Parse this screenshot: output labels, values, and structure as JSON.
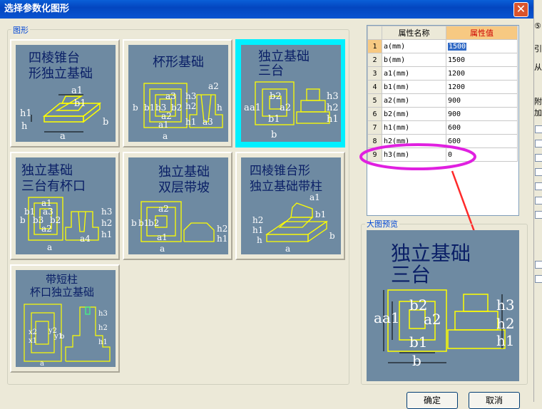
{
  "window": {
    "title": "选择参数化图形",
    "close_glyph": "✕"
  },
  "shapes_group": {
    "legend": "图形",
    "tiles": [
      {
        "title_lines": [
          "四棱锥台",
          "形独立基础"
        ],
        "dims": [
          "a1",
          "b1",
          "h1",
          "h",
          "b",
          "a"
        ]
      },
      {
        "title_lines": [
          "杯形基础"
        ],
        "dims": [
          "a2",
          "a3",
          "b3",
          "b2",
          "b",
          "b1",
          "a2",
          "a1",
          "h3",
          "h2",
          "h",
          "h1",
          "a3",
          "a"
        ]
      },
      {
        "title_lines": [
          "独立基础",
          "三台"
        ],
        "dims": [
          "a",
          "a1",
          "b2",
          "a2",
          "b1",
          "b",
          "h3",
          "h2",
          "h1"
        ]
      },
      {
        "title_lines": [
          "独立基础",
          "三台有杯口"
        ],
        "dims": [
          "a1",
          "b1",
          "b",
          "b3",
          "a3",
          "b2",
          "a2",
          "a",
          "h3",
          "h2",
          "h1",
          "a4"
        ]
      },
      {
        "title_lines": [
          "独立基础",
          "双层带坡"
        ],
        "dims": [
          "a2",
          "b",
          "b1",
          "b2",
          "a1",
          "a",
          "h2",
          "h1"
        ]
      },
      {
        "title_lines": [
          "四棱锥台形",
          "独立基础带柱"
        ],
        "dims": [
          "a1",
          "b1",
          "h2",
          "h1",
          "h",
          "b",
          "a"
        ]
      },
      {
        "title_lines": [
          "带短柱",
          "杯口独立基础"
        ],
        "dims": [
          "x1",
          "x2",
          "y2",
          "y1",
          "b",
          "a",
          "h3",
          "h2",
          "h1"
        ]
      }
    ]
  },
  "property_grid": {
    "headers": [
      "属性名称",
      "属性值"
    ],
    "rows": [
      {
        "num": "1",
        "name": "a(mm)",
        "value": "1500"
      },
      {
        "num": "2",
        "name": "b(mm)",
        "value": "1500"
      },
      {
        "num": "3",
        "name": "a1(mm)",
        "value": "1200"
      },
      {
        "num": "4",
        "name": "b1(mm)",
        "value": "1200"
      },
      {
        "num": "5",
        "name": "a2(mm)",
        "value": "900"
      },
      {
        "num": "6",
        "name": "b2(mm)",
        "value": "900"
      },
      {
        "num": "7",
        "name": "h1(mm)",
        "value": "600"
      },
      {
        "num": "8",
        "name": "h2(mm)",
        "value": "600"
      },
      {
        "num": "9",
        "name": "h3(mm)",
        "value": "0"
      }
    ]
  },
  "preview_group": {
    "legend": "大图预览",
    "title_lines": [
      "独立基础",
      "三台"
    ],
    "dims": [
      "a",
      "a1",
      "b2",
      "a2",
      "b1",
      "b",
      "h3",
      "h2",
      "h1"
    ]
  },
  "buttons": {
    "ok": "确定",
    "cancel": "取消"
  },
  "right_strip": {
    "labels": [
      "⑤",
      "引",
      "从",
      "附加"
    ]
  },
  "colors": {
    "tile_bg": "#6e8aa2",
    "drawing": "#ffff00",
    "title_text": "#0a1f66",
    "selection": "#00f0ff",
    "annotation": "#e020e0"
  }
}
